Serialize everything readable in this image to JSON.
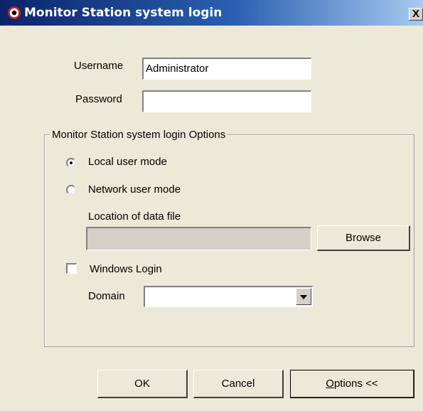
{
  "window": {
    "title": "Monitor Station system login",
    "close_label": "X"
  },
  "form": {
    "username_label": "Username",
    "username_value": "Administrator",
    "password_label": "Password",
    "password_value": ""
  },
  "options": {
    "group_label": "Monitor Station system login Options",
    "local_mode_label": "Local user mode",
    "local_mode_selected": true,
    "network_mode_label": "Network user mode",
    "network_mode_selected": false,
    "data_file_label": "Location of data file",
    "data_file_value": "",
    "browse_label": "Browse",
    "windows_login_label": "Windows Login",
    "windows_login_checked": false,
    "domain_label": "Domain",
    "domain_value": ""
  },
  "buttons": {
    "ok_label": "OK",
    "cancel_label": "Cancel",
    "options_label_mnemonic": "O",
    "options_label_rest": "ptions <<"
  },
  "colors": {
    "titlebar_start": "#0a246a",
    "titlebar_end": "#a6caf0",
    "dialog_bg": "#ece9d8"
  }
}
